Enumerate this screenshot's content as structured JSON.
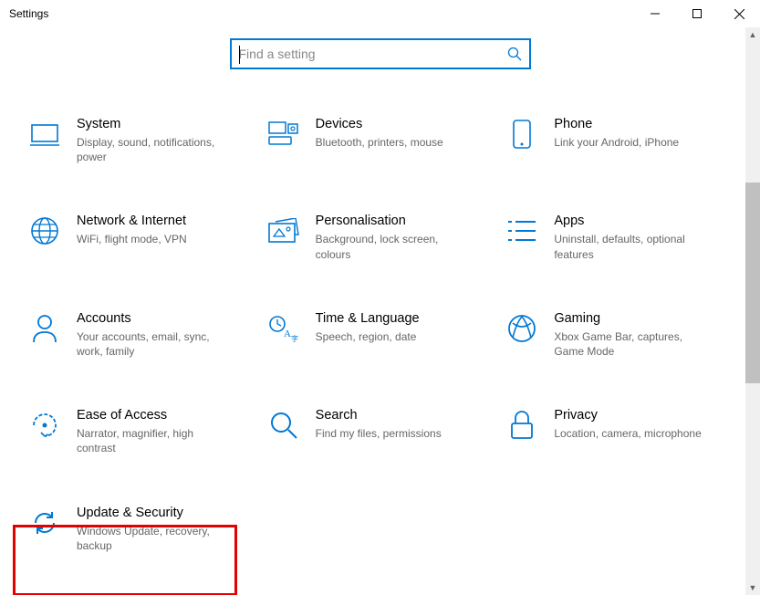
{
  "window": {
    "title": "Settings"
  },
  "search": {
    "placeholder": "Find a setting"
  },
  "tiles": [
    {
      "id": "system",
      "title": "System",
      "desc": "Display, sound, notifications, power"
    },
    {
      "id": "devices",
      "title": "Devices",
      "desc": "Bluetooth, printers, mouse"
    },
    {
      "id": "phone",
      "title": "Phone",
      "desc": "Link your Android, iPhone"
    },
    {
      "id": "network",
      "title": "Network & Internet",
      "desc": "WiFi, flight mode, VPN"
    },
    {
      "id": "personalisation",
      "title": "Personalisation",
      "desc": "Background, lock screen, colours"
    },
    {
      "id": "apps",
      "title": "Apps",
      "desc": "Uninstall, defaults, optional features"
    },
    {
      "id": "accounts",
      "title": "Accounts",
      "desc": "Your accounts, email, sync, work, family"
    },
    {
      "id": "time",
      "title": "Time & Language",
      "desc": "Speech, region, date"
    },
    {
      "id": "gaming",
      "title": "Gaming",
      "desc": "Xbox Game Bar, captures, Game Mode"
    },
    {
      "id": "ease",
      "title": "Ease of Access",
      "desc": "Narrator, magnifier, high contrast"
    },
    {
      "id": "search-cat",
      "title": "Search",
      "desc": "Find my files, permissions"
    },
    {
      "id": "privacy",
      "title": "Privacy",
      "desc": "Location, camera, microphone"
    },
    {
      "id": "update",
      "title": "Update & Security",
      "desc": "Windows Update, recovery, backup"
    }
  ],
  "colors": {
    "accent": "#0078d4",
    "highlight": "#e30000"
  }
}
